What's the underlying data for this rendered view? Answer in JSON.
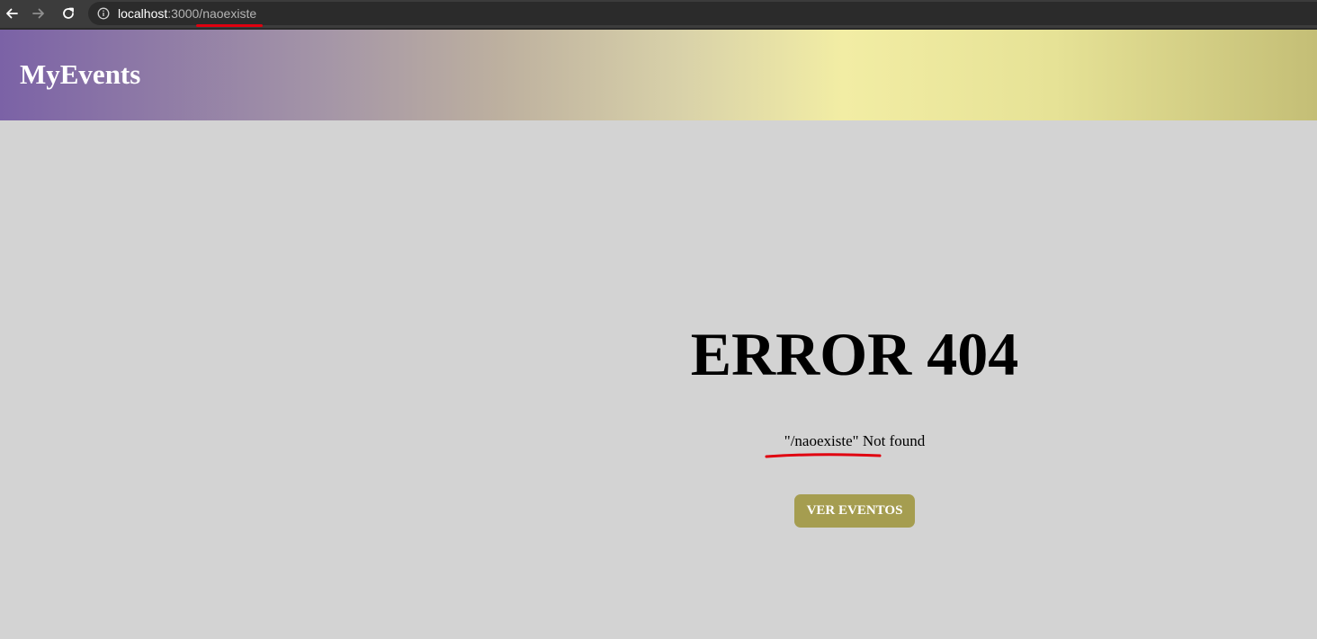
{
  "browser": {
    "url_host": "localhost",
    "url_path": ":3000/naoexiste",
    "icons": {
      "back": "arrow-left-icon",
      "forward": "arrow-right-icon",
      "reload": "reload-icon",
      "info": "info-icon"
    }
  },
  "header": {
    "brand": "MyEvents"
  },
  "error": {
    "title": "ERROR 404",
    "message": "\"/naoexiste\" Not found",
    "button_label": "VER EVENTOS"
  },
  "colors": {
    "page_background": "#d3d3d3",
    "button": "#a59d50",
    "annotation_red": "#e0000f",
    "header_gradient_start": "#7b62a6",
    "header_gradient_end": "#c4be76"
  }
}
